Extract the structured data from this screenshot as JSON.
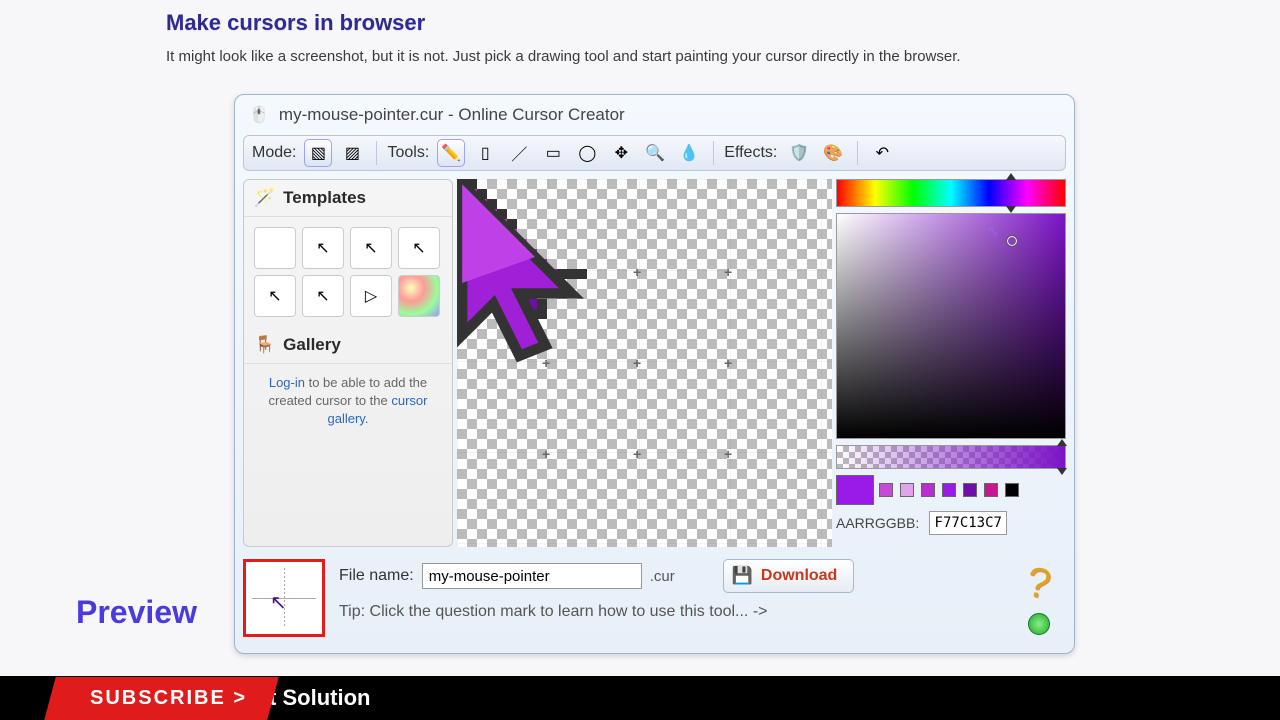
{
  "page": {
    "heading": "Make cursors in browser",
    "subtext": "It might look like a screenshot, but it is not. Just pick a drawing tool and start painting your cursor directly in the browser.",
    "preview_label": "Preview"
  },
  "window": {
    "title": "my-mouse-pointer.cur - Online Cursor Creator"
  },
  "toolbar": {
    "mode_label": "Mode:",
    "tools_label": "Tools:",
    "effects_label": "Effects:"
  },
  "sidebar": {
    "templates_header": "Templates",
    "gallery_header": "Gallery",
    "gallery_text_prefix": "Log-in",
    "gallery_text_mid": " to be able to add the created cursor to the ",
    "gallery_text_link": "cursor gallery",
    "gallery_text_suffix": "."
  },
  "color": {
    "hex_label": "AARRGGBB:",
    "hex_value": "F77C13C7",
    "swatches": [
      "#c74ad8",
      "#e0a5e8",
      "#b82ed0",
      "#9a1ae8",
      "#6e10a8",
      "#c81890",
      "#000000"
    ]
  },
  "footer": {
    "filename_label": "File name:",
    "filename_value": "my-mouse-pointer",
    "extension": ".cur",
    "download_label": "Download",
    "tip": "Tip: Click the question mark to learn how to use this tool... ->"
  },
  "banner": {
    "subscribe": "SUBSCRIBE >",
    "solution": "t Solution"
  }
}
